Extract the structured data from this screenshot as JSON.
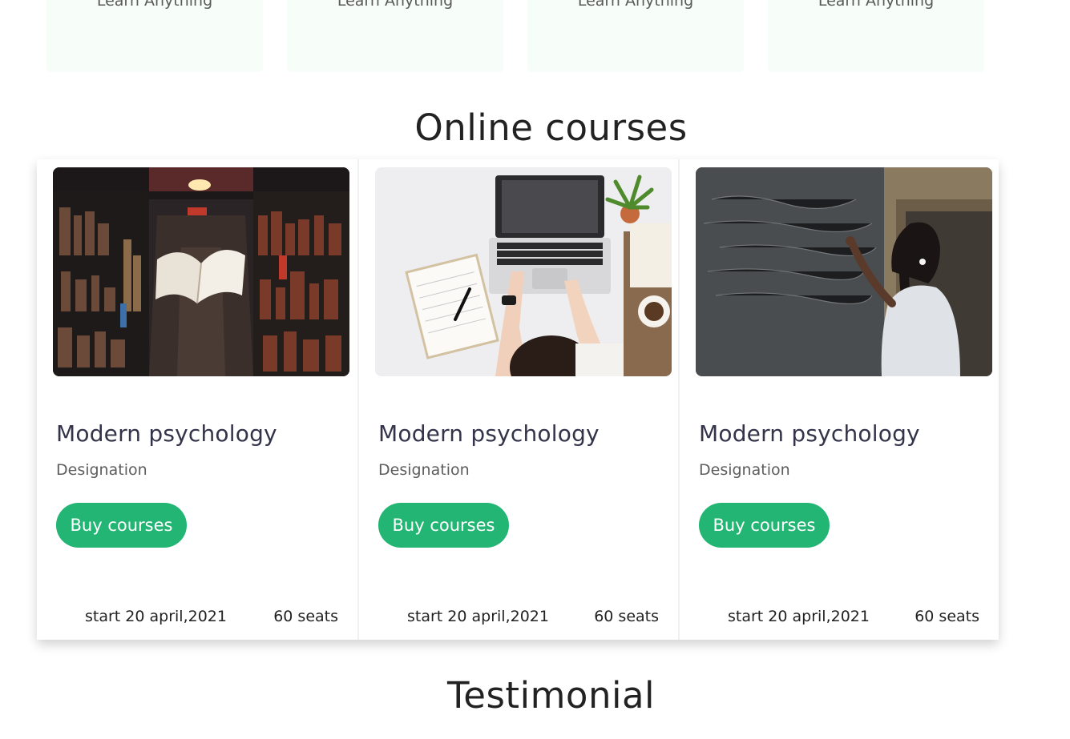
{
  "features": [
    {
      "label": "Learn Anything"
    },
    {
      "label": "Learn Anything"
    },
    {
      "label": "Learn Anything"
    },
    {
      "label": "Learn Anything"
    }
  ],
  "sections": {
    "online_title": "Online courses",
    "testimonial_title": "Testimonial"
  },
  "courses": [
    {
      "title": "Modern psychology",
      "subtitle": "Designation",
      "button": "Buy courses",
      "start": "start 20 april,2021",
      "seats": "60 seats",
      "image": "library-floating-book-photo"
    },
    {
      "title": "Modern psychology",
      "subtitle": "Designation",
      "button": "Buy courses",
      "start": "start 20 april,2021",
      "seats": "60 seats",
      "image": "laptop-desk-photo"
    },
    {
      "title": "Modern psychology",
      "subtitle": "Designation",
      "button": "Buy courses",
      "start": "start 20 april,2021",
      "seats": "60 seats",
      "image": "blackboard-student-photo"
    }
  ],
  "colors": {
    "accent": "#22b573",
    "feature_bg": "#f7fdf9",
    "title_text": "#33334a"
  }
}
